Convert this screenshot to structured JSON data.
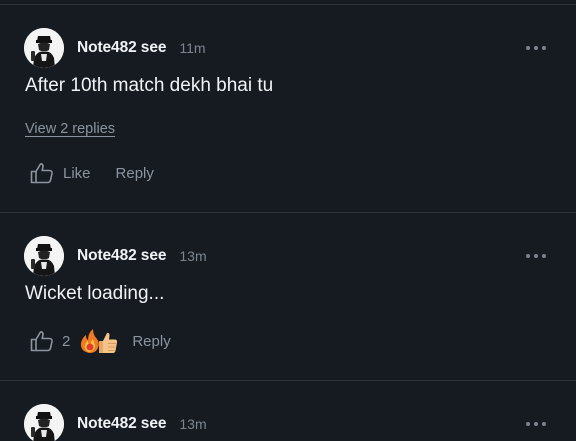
{
  "comments": [
    {
      "username": "Note482 see",
      "time": "11m",
      "text": "After 10th match dekh bhai tu",
      "view_replies": "View 2 replies",
      "like_label": "Like",
      "reply_label": "Reply"
    },
    {
      "username": "Note482 see",
      "time": "13m",
      "text": "Wicket loading...",
      "like_count": "2",
      "reactions": [
        "fire-icon",
        "thumbs-up-icon"
      ],
      "reply_label": "Reply"
    },
    {
      "username": "Note482 see",
      "time": "13m"
    }
  ],
  "colors": {
    "background": "#161b22",
    "divider": "#2d333b",
    "text": "#f0f3f6",
    "muted": "#8b949e"
  },
  "icons": {
    "more": "more-horizontal-icon",
    "like": "thumbs-up-outline-icon"
  }
}
